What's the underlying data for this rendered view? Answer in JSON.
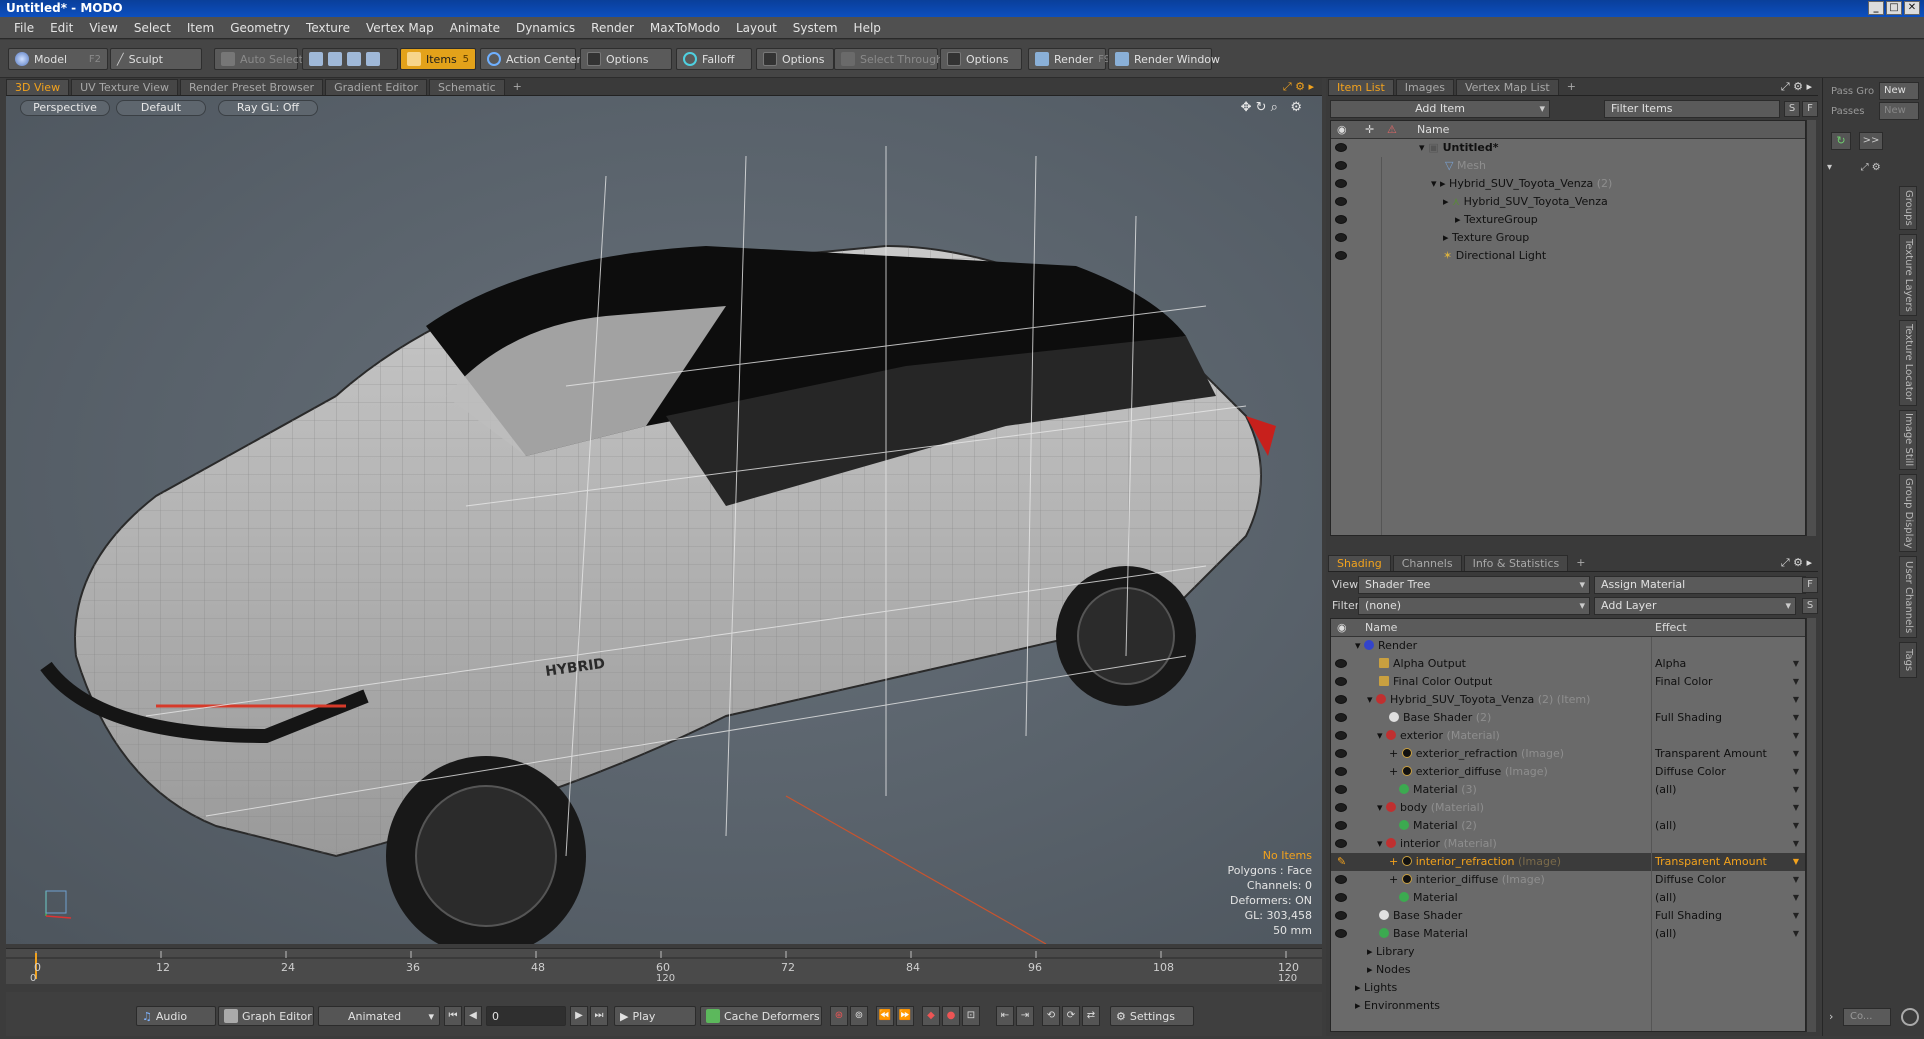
{
  "window": {
    "title": "Untitled* - MODO",
    "controls": [
      "_",
      "□",
      "✕"
    ]
  },
  "menu": [
    "File",
    "Edit",
    "View",
    "Select",
    "Item",
    "Geometry",
    "Texture",
    "Vertex Map",
    "Animate",
    "Dynamics",
    "Render",
    "MaxToModo",
    "Layout",
    "System",
    "Help"
  ],
  "toolbar": {
    "model": "Model",
    "model_key": "F2",
    "sculpt": "Sculpt",
    "auto_select": "Auto Select",
    "items": "Items",
    "items_key": "5",
    "action_center": "Action Center",
    "options1": "Options",
    "falloff": "Falloff",
    "options2": "Options",
    "select_through": "Select Through",
    "options3": "Options",
    "render": "Render",
    "render_key": "F9",
    "render_window": "Render Window"
  },
  "view_tabs": [
    "3D View",
    "UV Texture View",
    "Render Preset Browser",
    "Gradient Editor",
    "Schematic"
  ],
  "viewport": {
    "projection": "Perspective",
    "style": "Default",
    "raygl": "Ray GL: Off",
    "badge": "HYBRID",
    "info": [
      "No Items",
      "Polygons : Face",
      "Channels: 0",
      "Deformers: ON",
      "GL: 303,458",
      "50 mm"
    ],
    "accent": "#f2a21d"
  },
  "timeline": {
    "top_ticks": [
      "0",
      "12",
      "24",
      "36",
      "48",
      "60",
      "72",
      "84",
      "96",
      "108",
      "120"
    ],
    "bottom_ticks": [
      "0",
      "120",
      "120"
    ]
  },
  "bottombar": {
    "audio": "Audio",
    "graph_editor": "Graph Editor",
    "animated": "Animated",
    "frame": "0",
    "play": "Play",
    "cache": "Cache Deformers",
    "settings": "Settings"
  },
  "item_list": {
    "tabs": [
      "Item List",
      "Images",
      "Vertex Map List"
    ],
    "add_item": "Add Item",
    "filter": "Filter Items",
    "s_btn": "S",
    "f_btn": "F",
    "col_name": "Name",
    "rows": [
      {
        "label": "Untitled*",
        "extra": ""
      },
      {
        "label": "Mesh",
        "extra": ""
      },
      {
        "label": "Hybrid_SUV_Toyota_Venza",
        "extra": "(2)"
      },
      {
        "label": "Hybrid_SUV_Toyota_Venza",
        "extra": ""
      },
      {
        "label": "TextureGroup",
        "extra": ""
      },
      {
        "label": "Texture Group",
        "extra": ""
      },
      {
        "label": "Directional Light",
        "extra": ""
      }
    ]
  },
  "shading": {
    "tabs": [
      "Shading",
      "Channels",
      "Info & Statistics"
    ],
    "view_label": "View",
    "view_value": "Shader Tree",
    "assign": "Assign Material",
    "filter_label": "Filter",
    "filter_value": "(none)",
    "add_layer": "Add Layer",
    "s_btn": "S",
    "f_btn": "F",
    "col_name": "Name",
    "col_effect": "Effect",
    "rows": [
      {
        "label": "Render",
        "extra": "",
        "effect": ""
      },
      {
        "label": "Alpha Output",
        "extra": "",
        "effect": "Alpha"
      },
      {
        "label": "Final Color Output",
        "extra": "",
        "effect": "Final Color"
      },
      {
        "label": "Hybrid_SUV_Toyota_Venza",
        "extra": "(2) (Item)",
        "effect": ""
      },
      {
        "label": "Base Shader",
        "extra": "(2)",
        "effect": "Full Shading"
      },
      {
        "label": "exterior",
        "extra": "(Material)",
        "effect": ""
      },
      {
        "label": "exterior_refraction",
        "extra": "(Image)",
        "effect": "Transparent Amount"
      },
      {
        "label": "exterior_diffuse",
        "extra": "(Image)",
        "effect": "Diffuse Color"
      },
      {
        "label": "Material",
        "extra": "(3)",
        "effect": "(all)"
      },
      {
        "label": "body",
        "extra": "(Material)",
        "effect": ""
      },
      {
        "label": "Material",
        "extra": "(2)",
        "effect": "(all)"
      },
      {
        "label": "interior",
        "extra": "(Material)",
        "effect": ""
      },
      {
        "label": "interior_refraction",
        "extra": "(Image)",
        "effect": "Transparent Amount"
      },
      {
        "label": "interior_diffuse",
        "extra": "(Image)",
        "effect": "Diffuse Color"
      },
      {
        "label": "Material",
        "extra": "",
        "effect": "(all)"
      },
      {
        "label": "Base Shader",
        "extra": "",
        "effect": "Full Shading"
      },
      {
        "label": "Base Material",
        "extra": "",
        "effect": "(all)"
      },
      {
        "label": "Library",
        "extra": "",
        "effect": ""
      },
      {
        "label": "Nodes",
        "extra": "",
        "effect": ""
      },
      {
        "label": "Lights",
        "extra": "",
        "effect": ""
      },
      {
        "label": "Environments",
        "extra": "",
        "effect": ""
      }
    ]
  },
  "pass": {
    "pass_groups": "Pass Gro",
    "passes": "Passes",
    "new1": "New",
    "new2": "New",
    "more": ">>",
    "co": "Co..."
  },
  "side_tabs": [
    "Groups",
    "Texture Layers",
    "Texture Locator",
    "Image Still",
    "Group Display",
    "User Channels",
    "Tags"
  ]
}
